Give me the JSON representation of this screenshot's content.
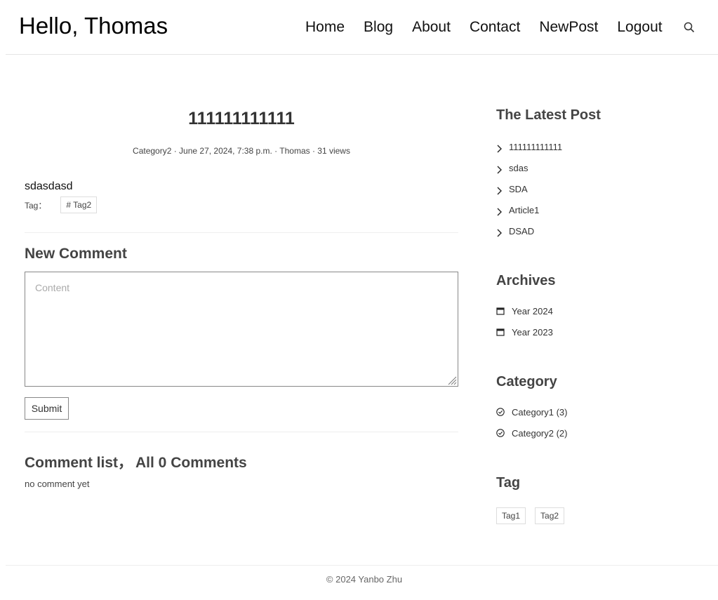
{
  "header": {
    "brand": "Hello, Thomas",
    "nav": [
      "Home",
      "Blog",
      "About",
      "Contact",
      "NewPost",
      "Logout"
    ],
    "search_icon": "search-icon"
  },
  "post": {
    "title": "111111111111",
    "meta": "Category2 · June 27, 2024, 7:38 p.m. · Thomas · 31 views",
    "body": "sdasdasd",
    "tag_label": "Tag：",
    "tags": [
      "# Tag2"
    ]
  },
  "comment_form": {
    "heading": "New Comment",
    "placeholder": "Content",
    "submit_label": "Submit"
  },
  "comment_list": {
    "heading": "Comment list，",
    "count_text": "All 0 Comments",
    "empty_text": "no comment yet"
  },
  "sidebar": {
    "latest_title": "The Latest Post",
    "latest": [
      "111111111111",
      "sdas",
      "SDA",
      "Article1",
      "DSAD"
    ],
    "archives_title": "Archives",
    "archives": [
      "Year 2024",
      "Year 2023"
    ],
    "category_title": "Category",
    "categories": [
      "Category1 (3)",
      "Category2 (2)"
    ],
    "tag_title": "Tag",
    "tags": [
      "Tag1",
      "Tag2"
    ]
  },
  "footer": {
    "text": "© 2024 Yanbo Zhu"
  }
}
